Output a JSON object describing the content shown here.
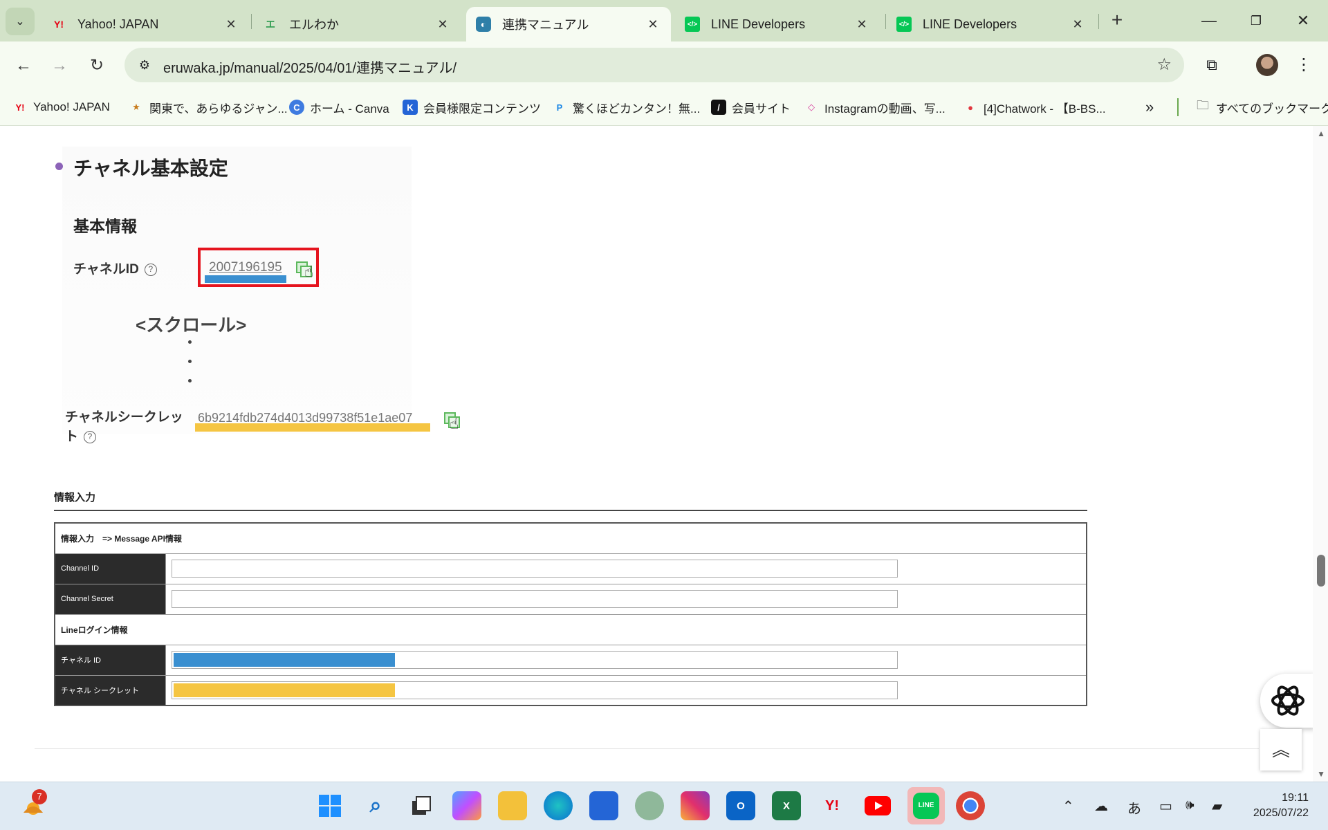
{
  "browser": {
    "tabs": [
      {
        "title": "Yahoo! JAPAN",
        "favicon": "Y!",
        "color": "#e60012",
        "active": false
      },
      {
        "title": "エルわか",
        "favicon": "エ",
        "color": "#2e9b4f",
        "active": false
      },
      {
        "title": "連携マニュアル",
        "favicon": "◐",
        "color": "#2e7fa8",
        "active": true
      },
      {
        "title": "LINE Developers",
        "favicon": "</>",
        "color": "#06c755",
        "active": false
      },
      {
        "title": "LINE Developers",
        "favicon": "</>",
        "color": "#06c755",
        "active": false
      }
    ],
    "url": "eruwaka.jp/manual/2025/04/01/連携マニュアル/",
    "bookmarks": [
      {
        "label": "Yahoo! JAPAN",
        "icon": "Y!",
        "color": "#e60012"
      },
      {
        "label": "関東で、あらゆるジャン...",
        "icon": "★",
        "color": "#c77a1a"
      },
      {
        "label": "ホーム - Canva",
        "icon": "C",
        "color": "#3e7be0"
      },
      {
        "label": "会員様限定コンテンツ",
        "icon": "K",
        "color": "#2464d6"
      },
      {
        "label": "驚くほどカンタン！無...",
        "icon": "P",
        "color": "#1e88e5"
      },
      {
        "label": "会員サイト",
        "icon": "/",
        "color": "#111111"
      },
      {
        "label": "Instagramの動画、写...",
        "icon": "◇",
        "color": "#d6409f"
      },
      {
        "label": "[4]Chatwork - 【B-BS...",
        "icon": "●",
        "color": "#e2373f"
      }
    ],
    "all_bookmarks": "すべてのブックマーク"
  },
  "page": {
    "section_title": "チャネル基本設定",
    "basic_info": "基本情報",
    "channel_id_label": "チャネルID",
    "channel_id_value": "2007196195",
    "scroll_note": "<スクロール>",
    "channel_secret_label": "チャネルシークレット",
    "channel_secret_value": "6b9214fdb274d4013d99738f51e1ae07",
    "help_glyph": "?",
    "input_heading": "情報入力",
    "table": {
      "group_1": "情報入力　=> Message API情報",
      "row_channel_id": "Channel ID",
      "row_channel_secret": "Channel Secret",
      "group_2": "Lineログイン情報",
      "row_ch_id_jp": "チャネル ID",
      "row_ch_secret_jp": "チャネル シークレット"
    },
    "highlight_colors": {
      "channel_id": "#3a8fd0",
      "channel_secret": "#f5c542",
      "box": "#e5141e"
    }
  },
  "taskbar": {
    "weather_badge": "7",
    "time": "19:11",
    "date": "2025/07/22",
    "ime": "あ"
  }
}
